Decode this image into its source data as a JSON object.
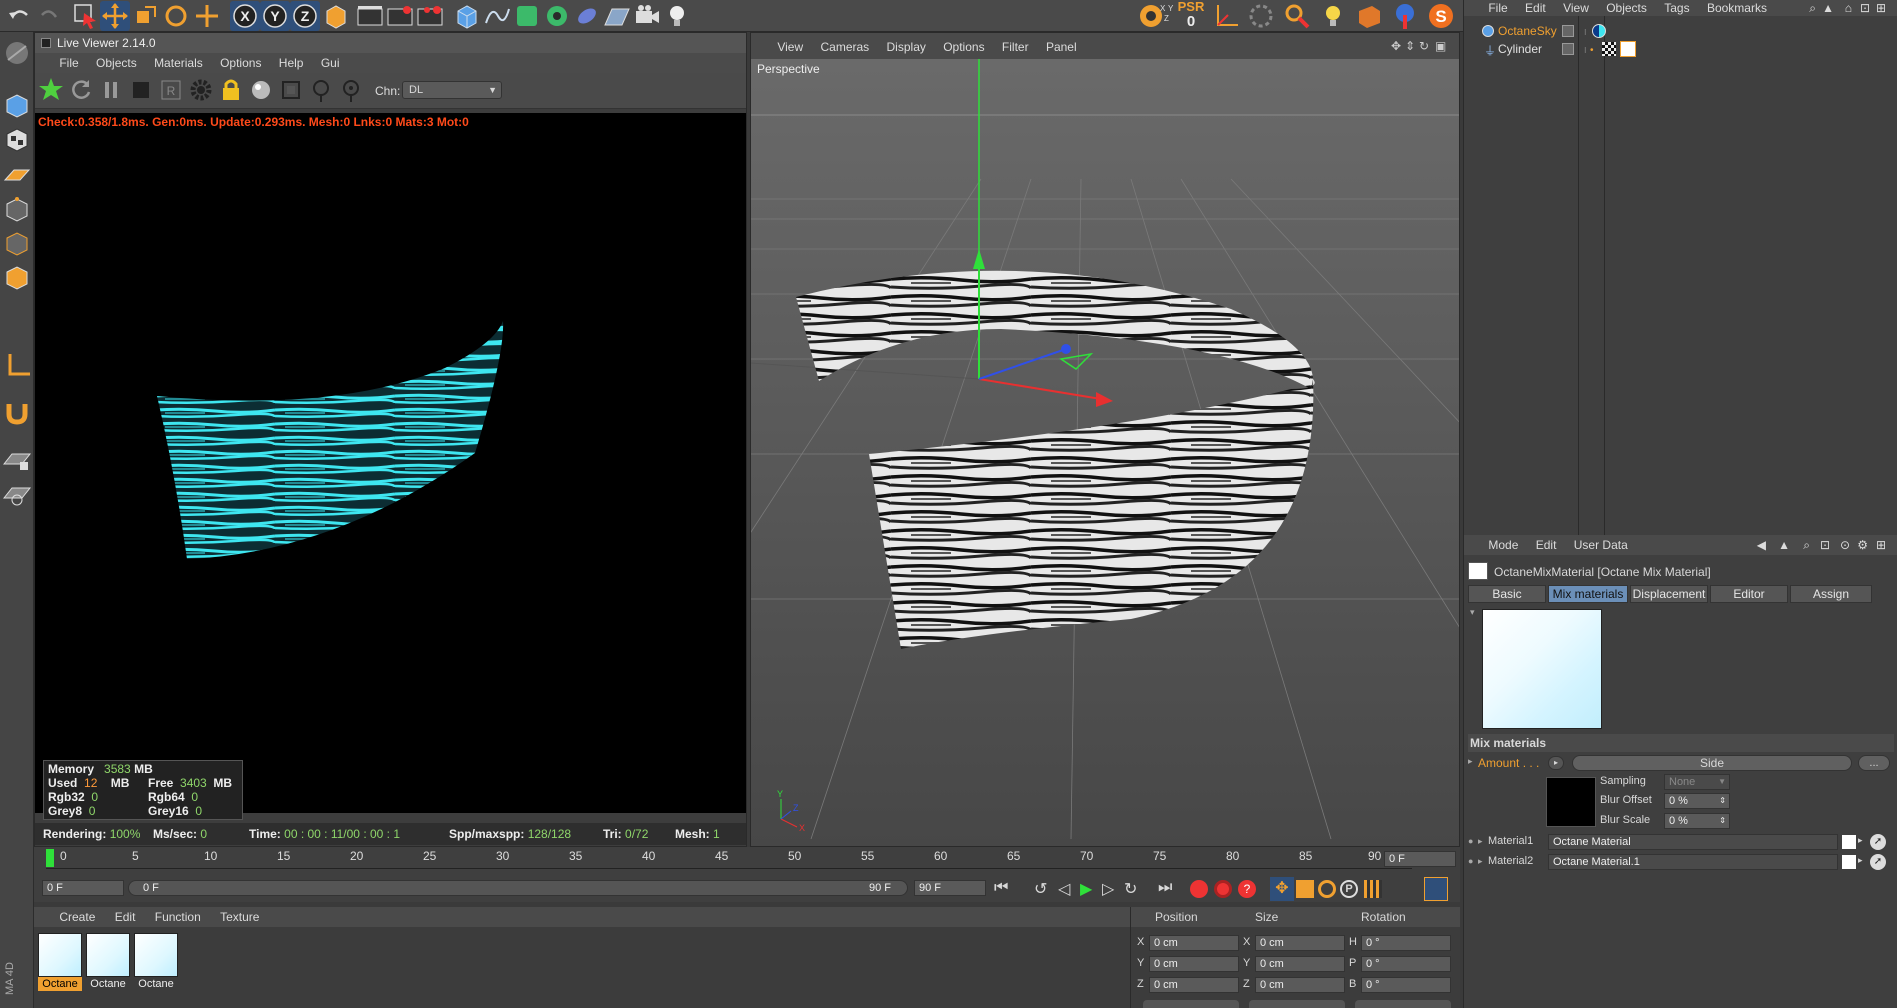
{
  "top_toolbar": {
    "icons": [
      "undo-icon",
      "redo-icon",
      "select-icon",
      "move-icon",
      "scale-icon",
      "rotate-icon",
      "transform-icon",
      "x-axis-icon",
      "y-axis-icon",
      "z-axis-icon",
      "coord-system-icon",
      "record-icon",
      "record-keys-icon",
      "autokey-icon",
      "cube-icon",
      "spline-icon",
      "nurbs-icon",
      "mograph-icon",
      "deformer-icon",
      "floor-icon",
      "camera-icon",
      "light-icon"
    ],
    "right_icons": [
      "octane-icon",
      "xyz-lock-icon",
      "psr-icon",
      "axis-icon",
      "snap-icon",
      "render-icon",
      "light-bulb-icon",
      "material-icon",
      "sculpt-icon",
      "s-icon"
    ],
    "psr_label": "PSR",
    "psr_value": "0"
  },
  "live_viewer": {
    "title": "Live Viewer 2.14.0",
    "menu": [
      "File",
      "Objects",
      "Materials",
      "Options",
      "Help",
      "Gui"
    ],
    "channel_label": "Chn:",
    "channel_value": "DL",
    "status_line": "Check:0.358/1.8ms. Gen:0ms. Update:0.293ms. Mesh:0 Lnks:0 Mats:3 Mot:0",
    "stats": {
      "memory_label": "Memory",
      "memory_value": "3583",
      "memory_unit": "MB",
      "used_label": "Used",
      "used_value": "12",
      "used_unit": "MB",
      "free_label": "Free",
      "free_value": "3403",
      "free_unit": "MB",
      "rgb32_label": "Rgb32",
      "rgb32_value": "0",
      "rgb64_label": "Rgb64",
      "rgb64_value": "0",
      "grey8_label": "Grey8",
      "grey8_value": "0",
      "grey16_label": "Grey16",
      "grey16_value": "0"
    },
    "footer": {
      "rendering_label": "Rendering:",
      "rendering_value": "100%",
      "mssec_label": "Ms/sec:",
      "mssec_value": "0",
      "time_label": "Time:",
      "time_value": "00 : 00 : 11/00 : 00 : 1",
      "spp_label": "Spp/maxspp:",
      "spp_value": "128/128",
      "tri_label": "Tri:",
      "tri_value": "0/72",
      "mesh_label": "Mesh:",
      "mesh_value": "1"
    }
  },
  "viewport": {
    "menu": [
      "View",
      "Cameras",
      "Display",
      "Options",
      "Filter",
      "Panel"
    ],
    "camera_label": "Perspective"
  },
  "object_manager": {
    "menu": [
      "File",
      "Edit",
      "View",
      "Objects",
      "Tags",
      "Bookmarks"
    ],
    "objects": [
      {
        "name": "OctaneSky",
        "color": "#f0a030"
      },
      {
        "name": "Cylinder",
        "color": "#e0e0e0"
      }
    ]
  },
  "attribute_manager": {
    "menu": [
      "Mode",
      "Edit",
      "User Data"
    ],
    "title": "OctaneMixMaterial [Octane Mix Material]",
    "tabs": [
      "Basic",
      "Mix materials",
      "Displacement",
      "Editor",
      "Assign"
    ],
    "active_tab": "Mix materials",
    "section_title": "Mix materials",
    "amount_label": "Amount . . .",
    "side_button": "Side",
    "more_button": "...",
    "sampling_label": "Sampling",
    "sampling_value": "None",
    "blur_offset_label": "Blur Offset",
    "blur_offset_value": "0 %",
    "blur_scale_label": "Blur Scale",
    "blur_scale_value": "0 %",
    "material1_label": "Material1",
    "material1_value": "Octane Material",
    "material2_label": "Material2",
    "material2_value": "Octane Material.1"
  },
  "timeline": {
    "ticks": [
      "0",
      "5",
      "10",
      "15",
      "20",
      "25",
      "30",
      "35",
      "40",
      "45",
      "50",
      "55",
      "60",
      "65",
      "70",
      "75",
      "80",
      "85",
      "90"
    ],
    "end_frame_field": "0 F",
    "start_field": "0 F",
    "range_start": "0 F",
    "range_end": "90 F",
    "max_field": "90 F"
  },
  "material_manager": {
    "menu": [
      "Create",
      "Edit",
      "Function",
      "Texture"
    ],
    "materials": [
      "Octane",
      "Octane",
      "Octane"
    ],
    "app_label": "MA 4D"
  },
  "coordinates": {
    "headers": [
      "Position",
      "Size",
      "Rotation"
    ],
    "rows": [
      {
        "axis": "X",
        "pos": "0 cm",
        "size_axis": "X",
        "size": "0 cm",
        "rot_axis": "H",
        "rot": "0 °"
      },
      {
        "axis": "Y",
        "pos": "0 cm",
        "size_axis": "Y",
        "size": "0 cm",
        "rot_axis": "P",
        "rot": "0 °"
      },
      {
        "axis": "Z",
        "pos": "0 cm",
        "size_axis": "Z",
        "size": "0 cm",
        "rot_axis": "B",
        "rot": "0 °"
      }
    ]
  },
  "colors": {
    "accent_orange": "#f0a030",
    "render_cyan": "#3ee6f0",
    "status_red": "#ff4a1a",
    "stat_green": "#8fd66a"
  }
}
